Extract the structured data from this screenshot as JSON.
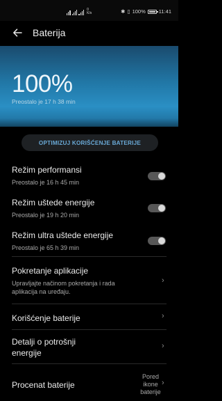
{
  "status_bar": {
    "network_tiny": "0\nK/s",
    "battery_text": "100%",
    "time": "11:41"
  },
  "header": {
    "title": "Baterija"
  },
  "hero": {
    "percent": "100%",
    "remaining": "Preostalo je 17 h 38 min",
    "level": 1.0
  },
  "optimize_button": "OPTIMIZUJ KORIŠĆENJE BATERIJE",
  "modes": [
    {
      "title": "Režim performansi",
      "subtitle": "Preostalo je 16 h 45 min",
      "enabled": false
    },
    {
      "title": "Režim uštede energije",
      "subtitle": "Preostalo je 19 h 20 min",
      "enabled": false
    },
    {
      "title": "Režim ultra uštede energije",
      "subtitle": "Preostalo je 65 h 39 min",
      "enabled": false
    }
  ],
  "menu": [
    {
      "title": "Pokretanje aplikacije",
      "subtitle_line1": "Upravljajte načinom pokretanja i rada",
      "subtitle_line2": "aplikacija na uređaju."
    },
    {
      "title": "Korišćenje baterije"
    },
    {
      "title_line1": "Detalji o potrošnji",
      "title_line2": "energije"
    },
    {
      "title": "Procenat baterije",
      "value_line1": "Pored",
      "value_line2": "ikone",
      "value_line3": "baterije"
    }
  ],
  "colors": {
    "accent": "#6aa9d6",
    "hero_top": "#1a4b6e",
    "hero_mid": "#2a8fc4"
  }
}
